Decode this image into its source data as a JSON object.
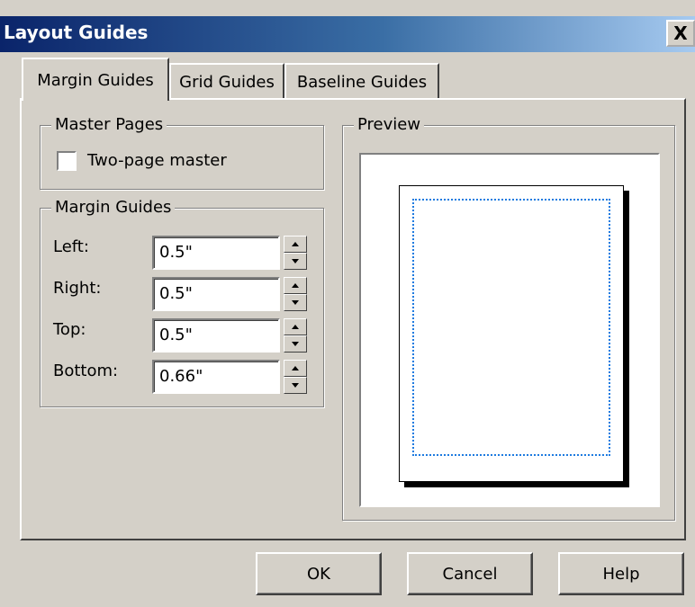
{
  "window": {
    "title": "Layout Guides",
    "close_label": "X"
  },
  "tabs": [
    {
      "label": "Margin Guides",
      "active": true
    },
    {
      "label": "Grid Guides",
      "active": false
    },
    {
      "label": "Baseline Guides",
      "active": false
    }
  ],
  "master_pages": {
    "legend": "Master Pages",
    "two_page_label": "Two-page master",
    "two_page_checked": false
  },
  "margin_guides": {
    "legend": "Margin Guides",
    "fields": [
      {
        "label": "Left:",
        "value": "0.5\""
      },
      {
        "label": "Right:",
        "value": "0.5\""
      },
      {
        "label": "Top:",
        "value": "0.5\""
      },
      {
        "label": "Bottom:",
        "value": "0.66\""
      }
    ]
  },
  "preview": {
    "legend": "Preview"
  },
  "buttons": {
    "ok": "OK",
    "cancel": "Cancel",
    "help": "Help"
  },
  "colors": {
    "title_start": "#0a246a",
    "title_end": "#a6caf0",
    "margin_guide": "#1e7be0",
    "face": "#d4d0c8"
  }
}
